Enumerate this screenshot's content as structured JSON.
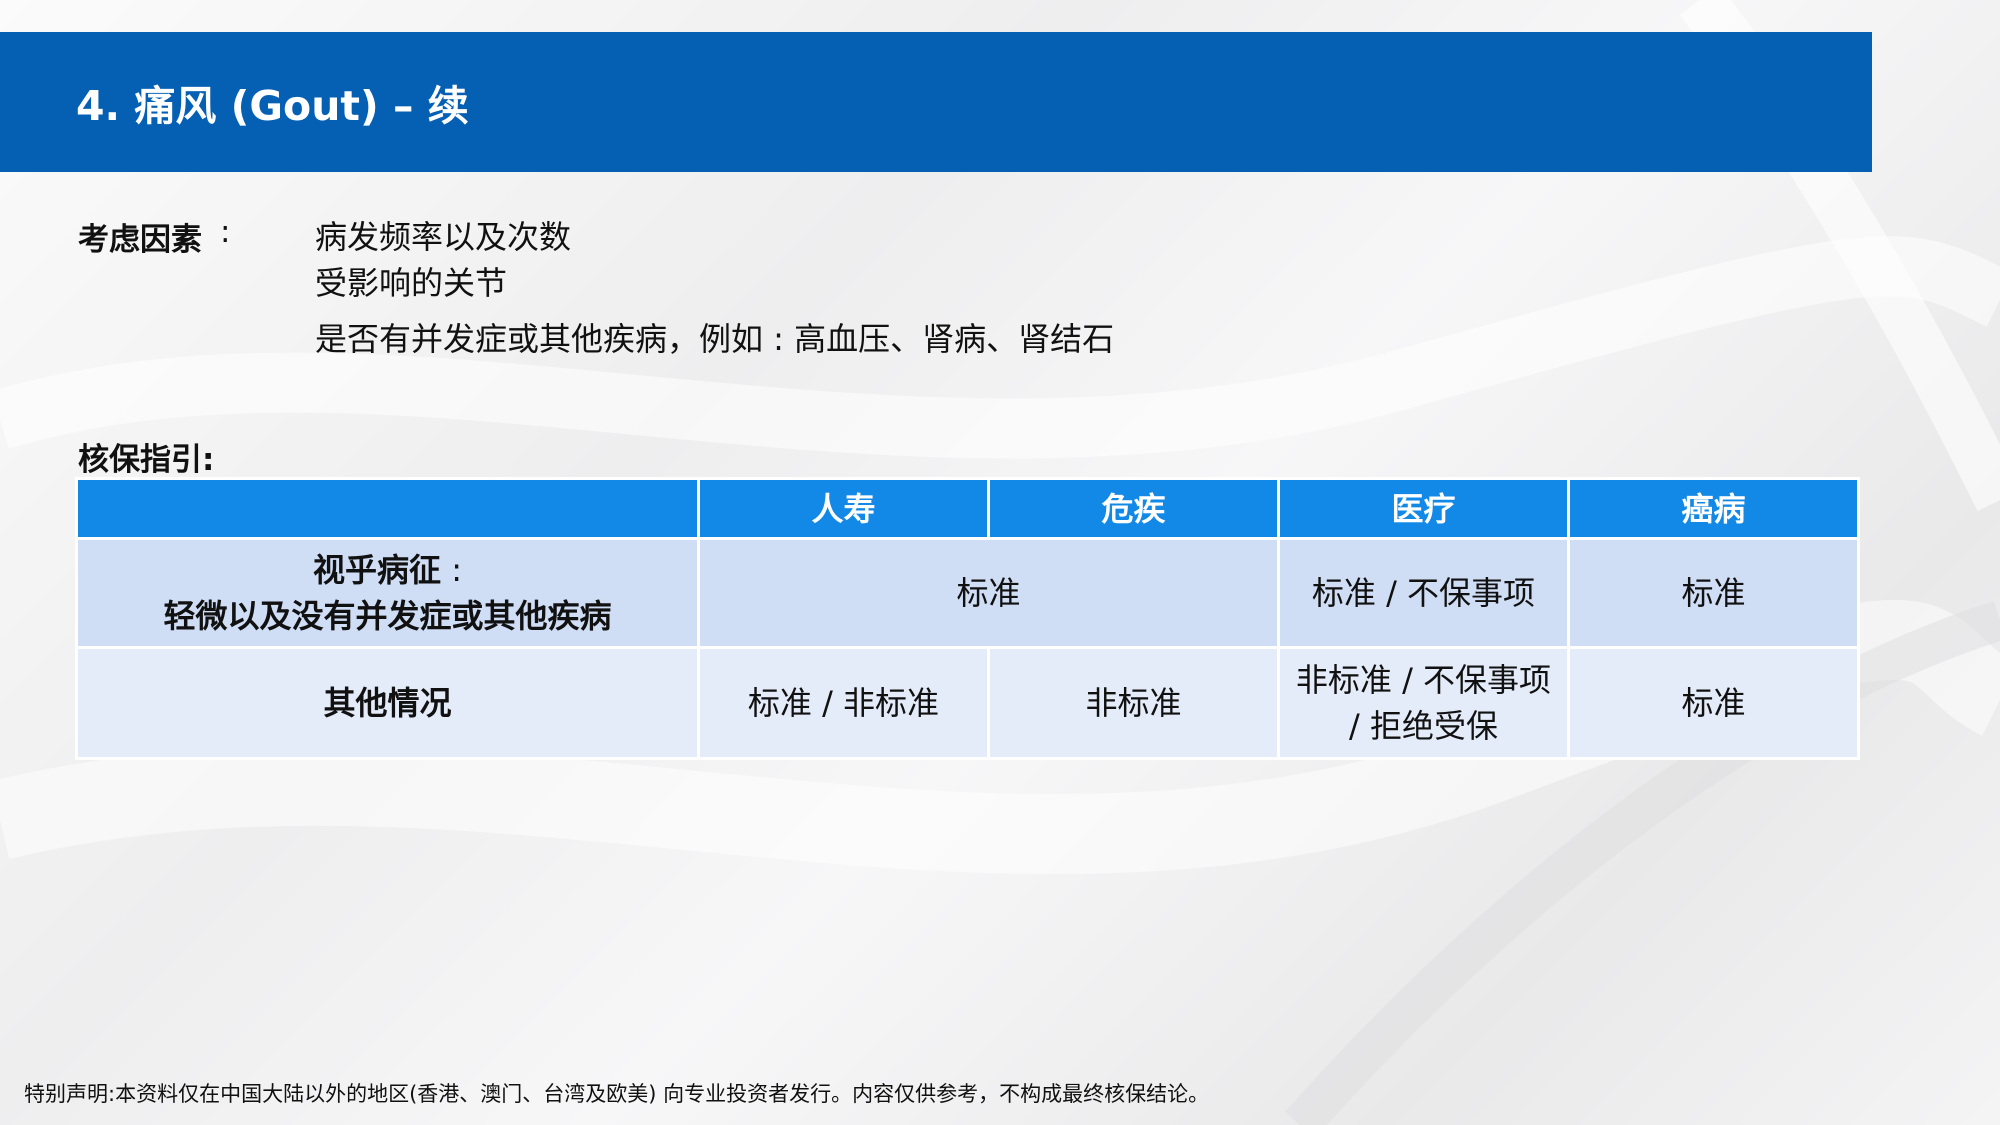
{
  "slide": {
    "title": "4. 痛风 (Gout) – 续"
  },
  "factors": {
    "label": "考虑因素",
    "colon": ":",
    "items": [
      "病发频率以及次数",
      "受影响的关节",
      "是否有并发症或其他疾病，例如 : 高血压、肾病、肾结石"
    ]
  },
  "guidelines": {
    "label": "核保指引:"
  },
  "table": {
    "headers": [
      "",
      "人寿",
      "危疾",
      "医疗",
      "癌病"
    ],
    "row1": {
      "condition_title": "视乎病征",
      "condition_colon": " :",
      "condition_detail": "轻微以及没有并发症或其他疾病",
      "life_ci": "标准",
      "medical": "标准 / 不保事项",
      "cancer": "标准"
    },
    "row2": {
      "condition": "其他情况",
      "life": "标准 / 非标准",
      "ci": "非标准",
      "medical_line1": "非标准 / 不保事项",
      "medical_line2": "/ 拒绝受保",
      "cancer": "标准"
    }
  },
  "footer": {
    "disclaimer": "特别声明:本资料仅在中国大陆以外的地区(香港、澳门、台湾及欧美) 向专业投资者发行。内容仅供参考，不构成最终核保结论。"
  },
  "colors": {
    "title_bar": "#0560b4",
    "table_header": "#1288e7",
    "row1_bg": "#cfddf5",
    "row2_bg": "#e5ecf9"
  }
}
